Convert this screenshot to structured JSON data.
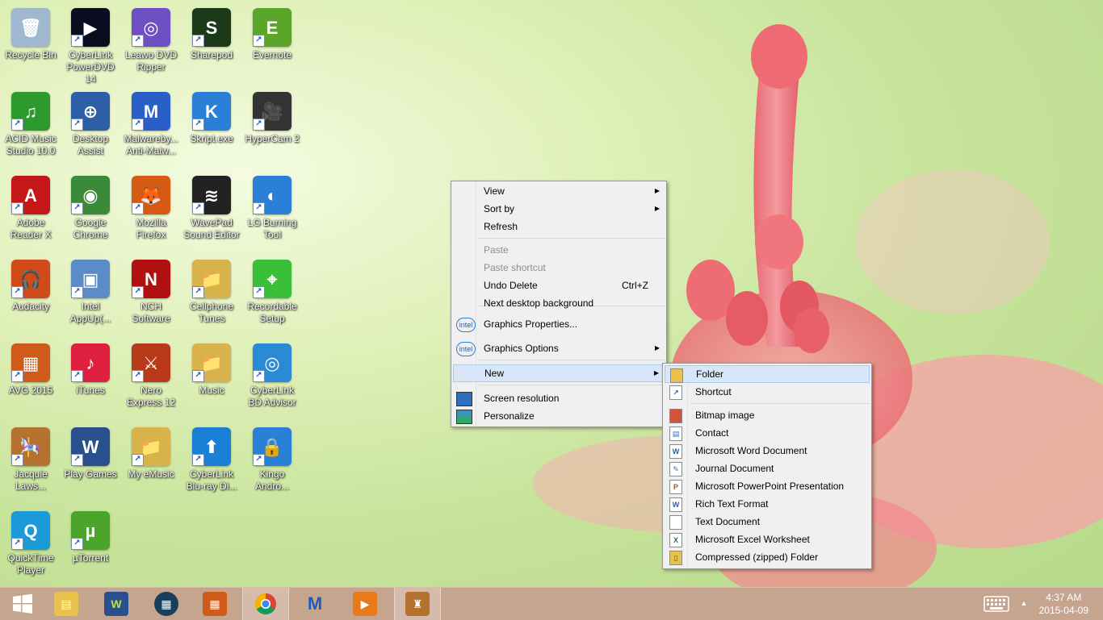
{
  "desktop": {
    "icons": [
      {
        "label": "Recycle Bin",
        "glyph": "🗑",
        "color": "#9fb8d0",
        "name": "recycle-bin-icon"
      },
      {
        "label": "CyberLink PowerDVD 14",
        "glyph": "▶",
        "color": "#0c0c20",
        "name": "powerdvd-icon"
      },
      {
        "label": "Leawo DVD Ripper",
        "glyph": "◎",
        "color": "#6d4fc2",
        "name": "dvd-disc-icon"
      },
      {
        "label": "Sharepod",
        "glyph": "S",
        "color": "#1a3a1a",
        "name": "sharepod-icon"
      },
      {
        "label": "Evernote",
        "glyph": "E",
        "color": "#5aa52a",
        "name": "evernote-icon"
      },
      {
        "label": "ACID Music Studio 10.0",
        "glyph": "♫",
        "color": "#2c9a2c",
        "name": "acid-music-icon"
      },
      {
        "label": "Desktop Assist",
        "glyph": "⊕",
        "color": "#2d5ea8",
        "name": "desktop-assist-icon"
      },
      {
        "label": "Malwareby... Anti-Malw...",
        "glyph": "M",
        "color": "#2a5fc7",
        "name": "malwarebytes-icon"
      },
      {
        "label": "Skript.exe",
        "glyph": "K",
        "color": "#2a7fd6",
        "name": "skript-icon"
      },
      {
        "label": "HyperCam 2",
        "glyph": "🎥",
        "color": "#333333",
        "name": "camera-icon"
      },
      {
        "label": "Adobe Reader X",
        "glyph": "A",
        "color": "#c41717",
        "name": "adobe-reader-icon"
      },
      {
        "label": "Google Chrome",
        "glyph": "◉",
        "color": "#3a8a3a",
        "name": "chrome-icon"
      },
      {
        "label": "Mozilla Firefox",
        "glyph": "🦊",
        "color": "#d65a14",
        "name": "firefox-icon"
      },
      {
        "label": "WavePad Sound Editor",
        "glyph": "≋",
        "color": "#222222",
        "name": "wavepad-icon"
      },
      {
        "label": "LG Burning Tool",
        "glyph": "◐",
        "color": "#2a7fd6",
        "name": "lg-burning-icon"
      },
      {
        "label": "Audacity",
        "glyph": "🎧",
        "color": "#d14a1a",
        "name": "audacity-icon"
      },
      {
        "label": "Intel AppUp(...",
        "glyph": "▣",
        "color": "#5b8cc7",
        "name": "intel-appup-icon"
      },
      {
        "label": "NCH Software",
        "glyph": "N",
        "color": "#b01010",
        "name": "nch-icon"
      },
      {
        "label": "Cellphone Tunes",
        "glyph": "📁",
        "color": "#d8b24a",
        "name": "folder-icon"
      },
      {
        "label": "Recordable Setup",
        "glyph": "⌖",
        "color": "#3abf3a",
        "name": "recordable-icon"
      },
      {
        "label": "AVG 2015",
        "glyph": "▦",
        "color": "#cf5a1a",
        "name": "avg-icon"
      },
      {
        "label": "iTunes",
        "glyph": "♪",
        "color": "#e02040",
        "name": "itunes-icon"
      },
      {
        "label": "Nero Express 12",
        "glyph": "⚔",
        "color": "#b83a1a",
        "name": "nero-icon"
      },
      {
        "label": "Music",
        "glyph": "📁",
        "color": "#d8b24a",
        "name": "folder-icon"
      },
      {
        "label": "CyberLink BD Advisor",
        "glyph": "◎",
        "color": "#2a8ad6",
        "name": "bd-advisor-icon"
      },
      {
        "label": "Jacquie Laws...",
        "glyph": "🎠",
        "color": "#b5722e",
        "name": "carousel-icon"
      },
      {
        "label": "Play Games",
        "glyph": "W",
        "color": "#2a4f8f",
        "name": "games-icon"
      },
      {
        "label": "My eMusic",
        "glyph": "📁",
        "color": "#d8b24a",
        "name": "folder-icon"
      },
      {
        "label": "CyberLink Blu-ray Di...",
        "glyph": "⬆",
        "color": "#1a7fd6",
        "name": "bluray-icon"
      },
      {
        "label": "Kingo Andro...",
        "glyph": "🔒",
        "color": "#2a7fd6",
        "name": "kingo-icon"
      },
      {
        "label": "QuickTime Player",
        "glyph": "Q",
        "color": "#1a9ad6",
        "name": "quicktime-icon"
      },
      {
        "label": "µTorrent",
        "glyph": "µ",
        "color": "#4aa52a",
        "name": "utorrent-icon"
      }
    ]
  },
  "context_menu": {
    "items": [
      {
        "label": "View",
        "submenu": true,
        "disabled": false
      },
      {
        "label": "Sort by",
        "submenu": true,
        "disabled": false
      },
      {
        "label": "Refresh",
        "disabled": false
      },
      {
        "label": "Paste",
        "disabled": true
      },
      {
        "label": "Paste shortcut",
        "disabled": true
      },
      {
        "label": "Undo Delete",
        "shortcut": "Ctrl+Z",
        "disabled": false
      },
      {
        "label": "Next desktop background",
        "disabled": false
      },
      {
        "label": "Graphics Properties...",
        "icon": "intel",
        "disabled": false
      },
      {
        "label": "Graphics Options",
        "icon": "intel",
        "submenu": true,
        "disabled": false
      },
      {
        "label": "New",
        "submenu": true,
        "highlighted": true,
        "disabled": false
      },
      {
        "label": "Screen resolution",
        "icon": "monitor",
        "disabled": false
      },
      {
        "label": "Personalize",
        "icon": "personalize",
        "disabled": false
      }
    ],
    "intel_badge": "intel"
  },
  "new_submenu": {
    "items": [
      {
        "label": "Folder",
        "highlighted": true
      },
      {
        "label": "Shortcut"
      },
      {
        "label": "Bitmap image"
      },
      {
        "label": "Contact"
      },
      {
        "label": "Microsoft Word Document"
      },
      {
        "label": "Journal Document"
      },
      {
        "label": "Microsoft PowerPoint Presentation"
      },
      {
        "label": "Rich Text Format"
      },
      {
        "label": "Text Document"
      },
      {
        "label": "Microsoft Excel Worksheet"
      },
      {
        "label": "Compressed (zipped) Folder"
      }
    ]
  },
  "taskbar": {
    "clock_time": "4:37 AM",
    "clock_date": "2015-04-09",
    "colors": {
      "bar": "#c6a58f",
      "accent": "#1e5bbd"
    }
  }
}
